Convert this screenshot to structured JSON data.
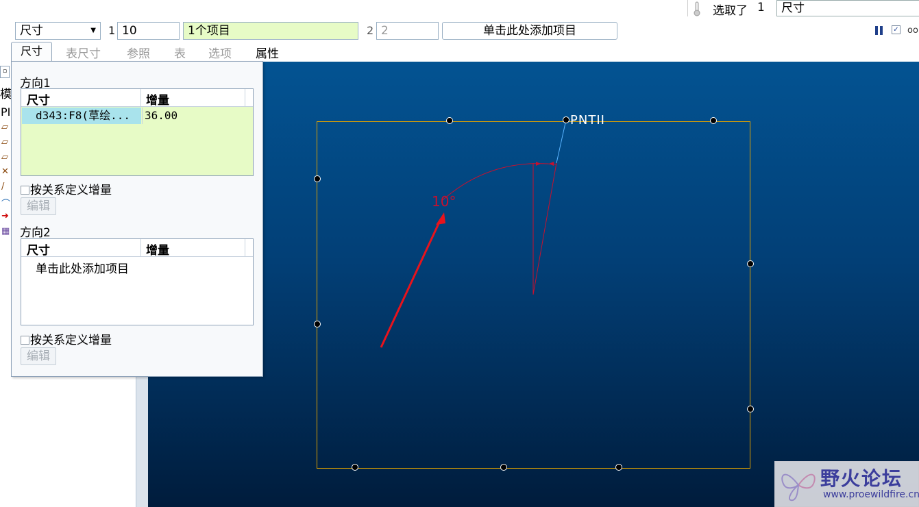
{
  "selection": {
    "label": "选取了",
    "count": "1",
    "filter_value": "尺寸"
  },
  "dashboard": {
    "type_value": "尺寸",
    "dir1_label": "1",
    "dir1_count": "10",
    "dir1_items": "1个项目",
    "dir2_label": "2",
    "dir2_count": "2",
    "dir2_add": "单击此处添加项目"
  },
  "tabs": [
    {
      "label": "尺寸",
      "active": true
    },
    {
      "label": "表尺寸",
      "active": false
    },
    {
      "label": "参照",
      "active": false
    },
    {
      "label": "表",
      "active": false
    },
    {
      "label": "选项",
      "active": false
    },
    {
      "label": "属性",
      "active": true
    }
  ],
  "tree": {
    "tab_label": "模",
    "row_label": "PI"
  },
  "panel": {
    "direction1": {
      "title": "方向1",
      "col_dim": "尺寸",
      "col_inc": "增量",
      "rows": [
        {
          "dim": "d343:F8(草绘...",
          "inc": "36.00"
        }
      ],
      "relation_checkbox": "按关系定义增量",
      "edit_button": "编辑"
    },
    "direction2": {
      "title": "方向2",
      "col_dim": "尺寸",
      "col_inc": "增量",
      "add_row": "单击此处添加项目",
      "relation_checkbox": "按关系定义增量",
      "edit_button": "编辑"
    }
  },
  "viewport": {
    "point_label": "PNTII",
    "angle_label": "10°",
    "colors": {
      "sketch": "#e0a100",
      "dimension": "#c8102e",
      "arrow": "#e8131c",
      "point_line": "#5ab4ff"
    }
  },
  "watermark": {
    "title": "野火论坛",
    "url": "www.proewildfire.cn"
  },
  "icons": {
    "thermometer": "thermometer-icon",
    "pause": "pause-icon",
    "check": "check-icon",
    "glasses": "glasses-icon"
  }
}
